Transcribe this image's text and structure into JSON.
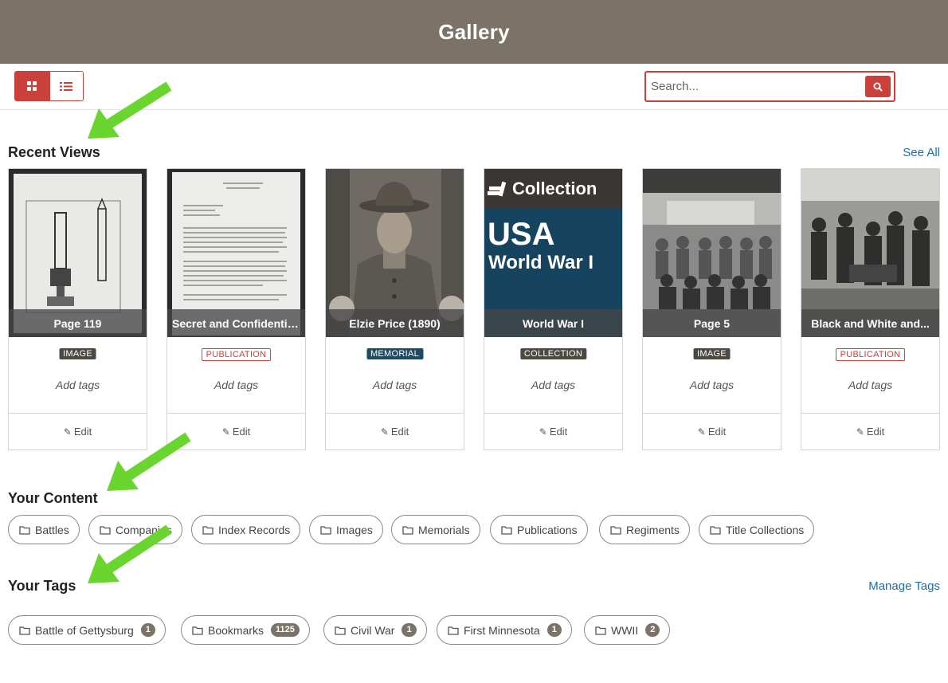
{
  "header": {
    "title": "Gallery"
  },
  "toolbar": {
    "grid_icon": "grid-icon",
    "list_icon": "list-icon",
    "search_placeholder": "Search...",
    "search_icon": "search-icon"
  },
  "recent": {
    "title": "Recent Views",
    "see_all": "See All",
    "items": [
      {
        "caption": "Page 119",
        "badge": "IMAGE",
        "add_tags": "Add tags",
        "edit": "Edit"
      },
      {
        "caption": "Secret and Confidential Memo...",
        "badge": "PUBLICATION",
        "add_tags": "Add tags",
        "edit": "Edit"
      },
      {
        "caption": "Elzie Price (1890)",
        "badge": "MEMORIAL",
        "add_tags": "Add tags",
        "edit": "Edit"
      },
      {
        "caption": "World War I",
        "badge": "COLLECTION",
        "add_tags": "Add tags",
        "edit": "Edit",
        "thumb_header": "Collection",
        "thumb_line1": "USA",
        "thumb_line2": "World War I"
      },
      {
        "caption": "Page 5",
        "badge": "IMAGE",
        "add_tags": "Add tags",
        "edit": "Edit"
      },
      {
        "caption": "Black and White and...",
        "badge": "PUBLICATION",
        "add_tags": "Add tags",
        "edit": "Edit"
      }
    ]
  },
  "content": {
    "title": "Your Content",
    "items": [
      "Battles",
      "Companies",
      "Index Records",
      "Images",
      "Memorials",
      "Publications",
      "Regiments",
      "Title Collections"
    ]
  },
  "tags": {
    "title": "Your Tags",
    "manage": "Manage Tags",
    "items": [
      {
        "label": "Battle of Gettysburg",
        "count": "1"
      },
      {
        "label": "Bookmarks",
        "count": "1125"
      },
      {
        "label": "Civil War",
        "count": "1"
      },
      {
        "label": "First Minnesota",
        "count": "1"
      },
      {
        "label": "WWII",
        "count": "2"
      }
    ]
  },
  "colors": {
    "header_bg": "#7b7268",
    "accent": "#c9413a",
    "link": "#1f6ea8",
    "annotation_arrow": "#6ad52f"
  }
}
